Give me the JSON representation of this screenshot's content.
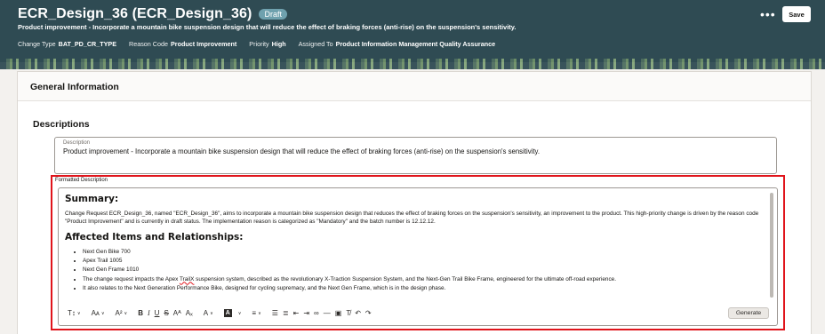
{
  "header": {
    "title": "ECR_Design_36 (ECR_Design_36)",
    "status_badge": "Draft",
    "subtitle": "Product improvement - Incorporate a mountain bike suspension design that will reduce the effect of braking forces (anti-rise) on the suspension's sensitivity.",
    "meta": [
      {
        "label": "Change Type",
        "value": "BAT_PD_CR_TYPE"
      },
      {
        "label": "Reason Code",
        "value": "Product Improvement"
      },
      {
        "label": "Priority",
        "value": "High"
      },
      {
        "label": "Assigned To",
        "value": "Product Information Management Quality Assurance"
      }
    ],
    "more_label": "•••",
    "save_label": "Save"
  },
  "card": {
    "title": "General Information"
  },
  "descriptions": {
    "section_title": "Descriptions",
    "description_label": "Description",
    "description_value": "Product improvement - Incorporate a mountain bike suspension design that will reduce the effect of braking forces (anti-rise) on the suspension's sensitivity.",
    "formatted_label": "Formatted Description",
    "summary_heading": "Summary:",
    "summary_text": "Change Request ECR_Design_36, named \"ECR_Design_36\", aims to incorporate a mountain bike suspension design that reduces the effect of braking forces on the suspension's sensitivity, an improvement to the product. This high-priority change is driven by the reason code \"Product Improvement\" and is currently in draft status. The implementation reason is categorized as \"Mandatory\" and the batch number is 12.12.12.",
    "affected_heading": "Affected Items and Relationships:",
    "items": [
      "Next Gen Bike 700",
      "Apex Trail 1005",
      "Next Gen Frame 1010"
    ],
    "impact_prefix": "The change request impacts the Apex ",
    "impact_misspelled": "TrailX",
    "impact_suffix": " suspension system, described as the revolutionary X-Traction Suspension System, and the Next-Gen Trail Bike Frame, engineered for the ultimate off-road experience.",
    "relates_text": "It also relates to the Next Generation Performance Bike, designed for cycling supremacy, and the Next Gen Frame, which is in the design phase.",
    "generate_label": "Generate"
  },
  "toolbar": {
    "format_icon": "T↕",
    "font_size_icon": "Aᴀ",
    "superscript_icon": "A²",
    "bold_icon": "B",
    "italic_icon": "I",
    "underline_icon": "U",
    "strike_icon": "S",
    "case_icon": "Aᴬ",
    "clear_case_icon": "Aₓ",
    "font_color_icon": "A",
    "highlight_icon": "A",
    "align_icon": "≡",
    "bullets_icon": "☰",
    "numbered_icon": "≣",
    "outdent_icon": "⇤",
    "indent_icon": "⇥",
    "link_icon": "∞",
    "hr_icon": "—",
    "embed_icon": "▣",
    "clear_format_icon": "T̸",
    "undo_icon": "↶",
    "redo_icon": "↷",
    "chevron": "∨"
  },
  "colors": {
    "header_bg": "#2f4b53",
    "badge_bg": "#6fa1ae",
    "highlight_border": "#e0141b"
  }
}
